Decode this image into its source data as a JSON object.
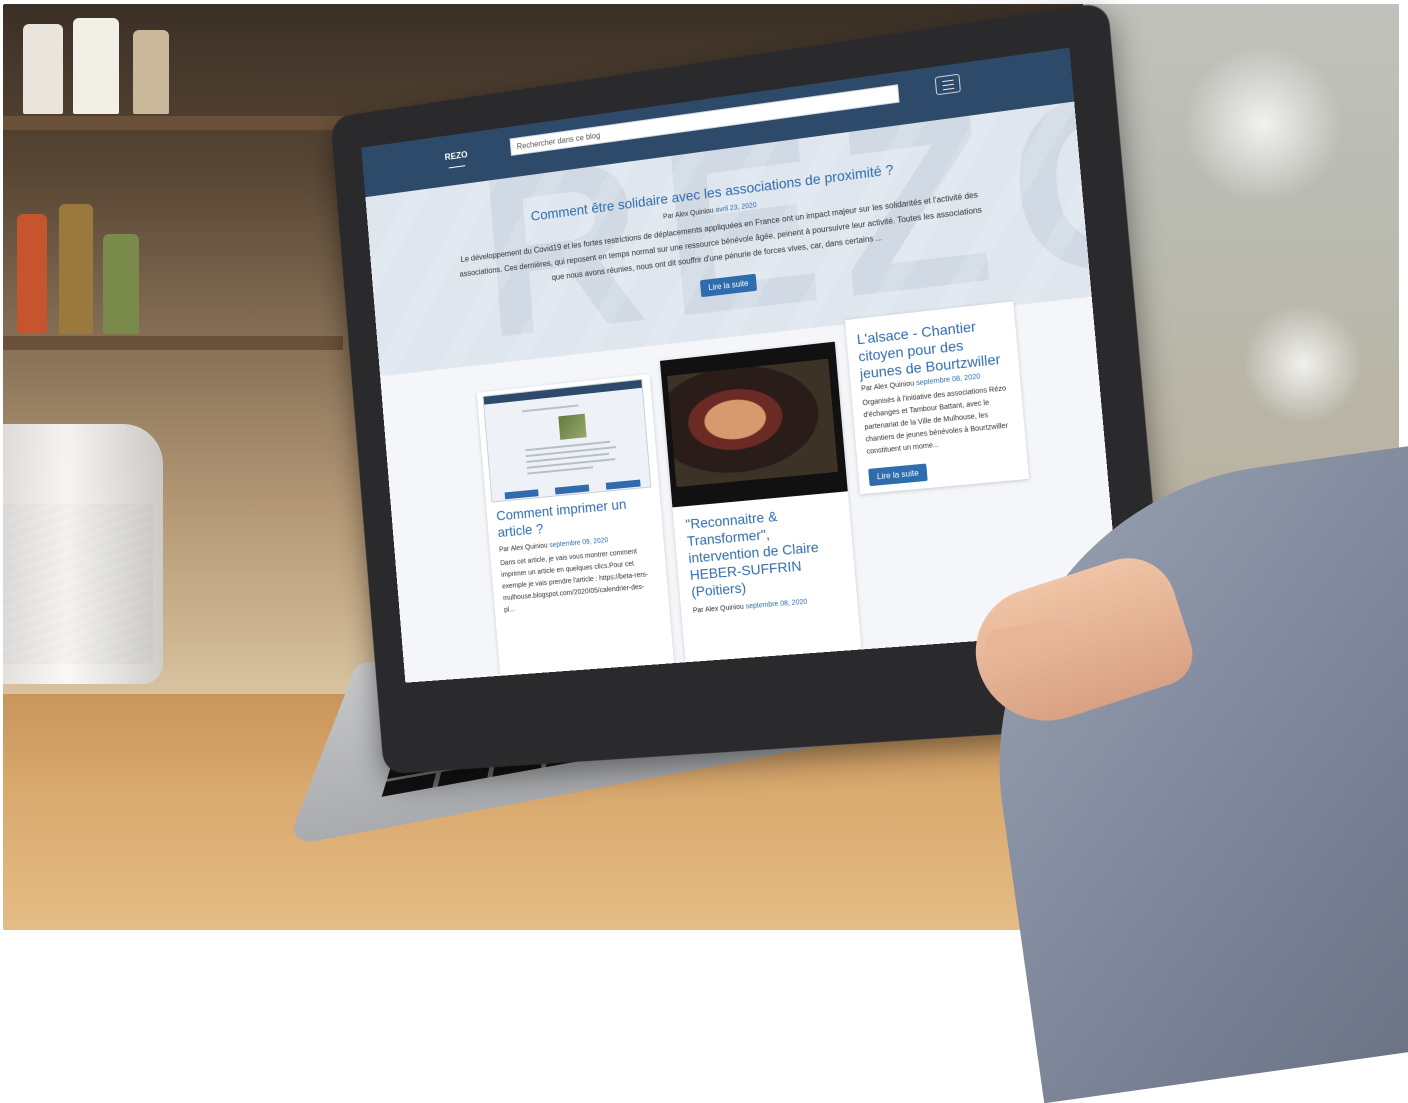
{
  "site": {
    "logo_text": "REZO",
    "search_placeholder": "Rechercher dans ce blog",
    "menu_icon": "hamburger-icon"
  },
  "featured": {
    "title": "Comment être solidaire avec les associations de proximité ?",
    "author_prefix": "Par Alex Quiniou",
    "date": "avril 23, 2020",
    "excerpt": "Le développement du Covid19 et les fortes restrictions de déplacements appliquées en France ont un impact majeur sur les solidarités et l'activité des associations. Ces dernières, qui reposent en temps normal sur une ressource bénévole âgée, peinent à poursuivre leur activité. Toutes les associations que nous avons réunies, nous ont dit souffrir d'une pénurie de forces vives, car, dans certains ...",
    "button": "Lire la suite"
  },
  "cards": [
    {
      "title": "Comment imprimer un article ?",
      "author_prefix": "Par Alex Quiniou",
      "date": "septembre 09, 2020",
      "excerpt": "Dans cet article, je vais vous montrer comment imprimer un article en quelques clics.Pour cet exemple je vais prendre l'article : https://beta-rers-mulhouse.blogspot.com/2020/05/calendrier-des-pl..."
    },
    {
      "title": "\"Reconnaitre & Transformer\", intervention de Claire HEBER-SUFFRIN (Poitiers)",
      "author_prefix": "Par Alex Quiniou",
      "date": "septembre 08, 2020"
    },
    {
      "title": "L'alsace - Chantier citoyen pour des jeunes de Bourtzwiller",
      "author_prefix": "Par Alex Quiniou",
      "date": "septembre 08, 2020",
      "excerpt": "Organisés à l'initiative des associations Rézo d'échanges et Tambour Battant, avec le partenariat de la Ville de Mulhouse, les chantiers de jeunes bénévoles à Bourtzwiller constituent un mome...",
      "button": "Lire la suite"
    }
  ]
}
